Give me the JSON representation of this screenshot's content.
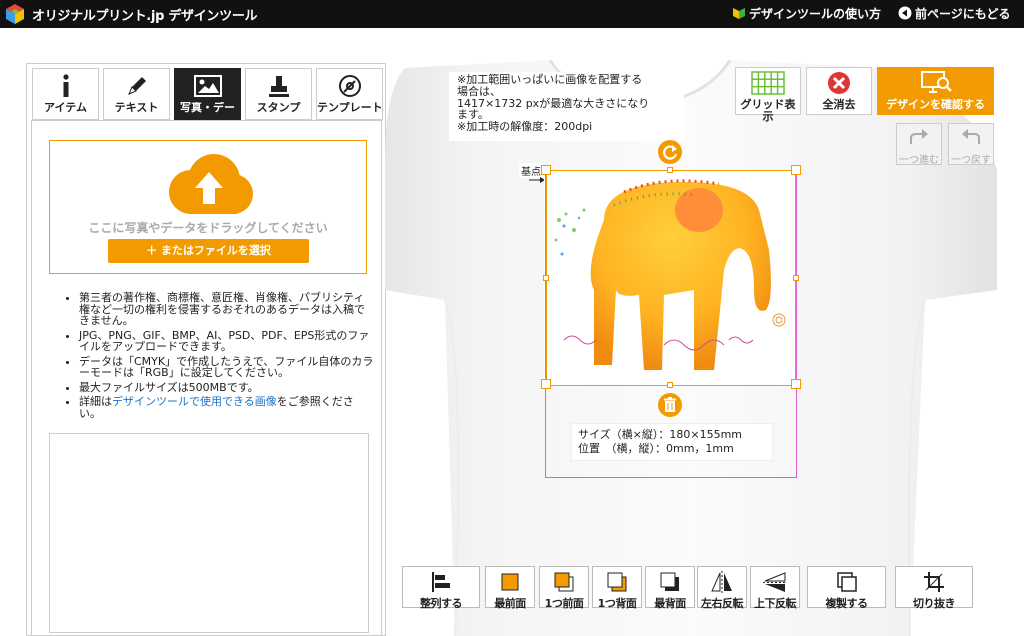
{
  "header": {
    "brand": "オリジナルプリント.jp デザインツール",
    "guide_link": "デザインツールの使い方",
    "back_link": "前ページにもどる"
  },
  "tabs": [
    {
      "label": "アイテム",
      "icon": "info-icon"
    },
    {
      "label": "テキスト",
      "icon": "pen-icon"
    },
    {
      "label": "写真・デー",
      "icon": "image-icon",
      "active": true
    },
    {
      "label": "スタンプ",
      "icon": "stamp-icon"
    },
    {
      "label": "テンプレート",
      "icon": "template-icon"
    }
  ],
  "upload": {
    "drop_text": "ここに写真やデータをドラッグしてください",
    "file_button": "＋ またはファイルを選択"
  },
  "notes": {
    "n1": "第三者の著作権、商標権、意匠権、肖像権、パブリシティ権など一切の権利を侵害するおそれのあるデータは入稿できません。",
    "n2": "JPG、PNG、GIF、BMP、AI、PSD、PDF、EPS形式のファイルをアップロードできます。",
    "n3": "データは「CMYK」で作成したうえで、ファイル自体のカラーモードは「RGB」に設定してください。",
    "n4": "最大ファイルサイズは500MBです。",
    "n5_pre": "詳細は",
    "n5_link": "デザインツールで使用できる画像",
    "n5_post": "をご参照ください。"
  },
  "hint": {
    "line1": "※加工範囲いっぱいに画像を配置する",
    "line2": "場合は、",
    "line3": "1417×1732 pxが最適な大きさになり",
    "line4": "ます。",
    "line5": "※加工時の解像度：200dpi"
  },
  "top_buttons": {
    "grid": "グリッド表示",
    "clear": "全消去",
    "confirm": "デザインを確認する",
    "redo": "一つ進む",
    "undo": "一つ戻す"
  },
  "canvas": {
    "origin_label": "基点",
    "size_line": "サイズ（横×縦）：180×155mm",
    "pos_line": "位置　（横，縦）：0mm，1mm"
  },
  "toolbar": [
    {
      "label": "整列する",
      "icon": "align-icon"
    },
    {
      "label": "最前面",
      "icon": "bring-front-icon"
    },
    {
      "label": "1つ前面",
      "icon": "bring-forward-icon"
    },
    {
      "label": "1つ背面",
      "icon": "send-backward-icon"
    },
    {
      "label": "最背面",
      "icon": "send-back-icon"
    },
    {
      "label": "左右反転",
      "icon": "flip-horizontal-icon"
    },
    {
      "label": "上下反転",
      "icon": "flip-vertical-icon"
    },
    {
      "label": "複製する",
      "icon": "duplicate-icon"
    },
    {
      "label": "切り抜き",
      "icon": "crop-icon"
    }
  ],
  "colors": {
    "accent": "#f39a00",
    "header_bg": "#111111",
    "link": "#1a73c8",
    "selection": "#e25ed5"
  }
}
